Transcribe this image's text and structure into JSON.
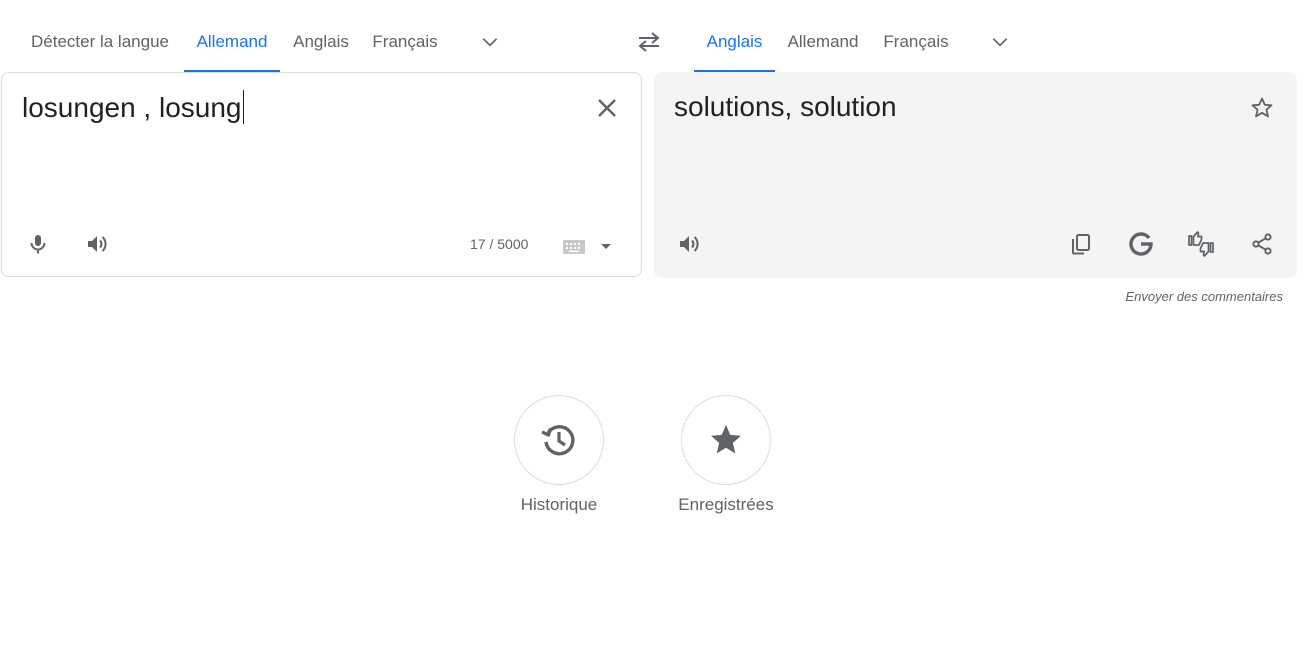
{
  "source_languages": {
    "tabs": [
      {
        "label": "Détecter la langue"
      },
      {
        "label": "Allemand",
        "active": true
      },
      {
        "label": "Anglais"
      },
      {
        "label": "Français"
      }
    ],
    "more_icon": "chevron-down-icon"
  },
  "swap_icon": "swap-arrows-icon",
  "target_languages": {
    "tabs": [
      {
        "label": "Anglais",
        "active": true
      },
      {
        "label": "Allemand"
      },
      {
        "label": "Français"
      }
    ],
    "more_icon": "chevron-down-icon"
  },
  "source": {
    "text": "losungen , losung",
    "char_count": "17 / 5000",
    "icons": [
      "close-icon",
      "microphone-icon",
      "speaker-icon",
      "keyboard-icon",
      "caret-down-icon"
    ]
  },
  "target": {
    "text": "solutions, solution",
    "icons": [
      "star-outline-icon",
      "speaker-icon",
      "copy-icon",
      "google-icon",
      "feedback-icon",
      "share-icon"
    ]
  },
  "feedback_link": "Envoyer des commentaires",
  "actions": [
    {
      "label": "Historique",
      "icon": "history-icon"
    },
    {
      "label": "Enregistrées",
      "icon": "star-icon"
    }
  ],
  "colors": {
    "accent": "#1a73e8",
    "text": "#3c4043",
    "muted": "#5f6368",
    "target_bg": "#f4f4f4"
  }
}
